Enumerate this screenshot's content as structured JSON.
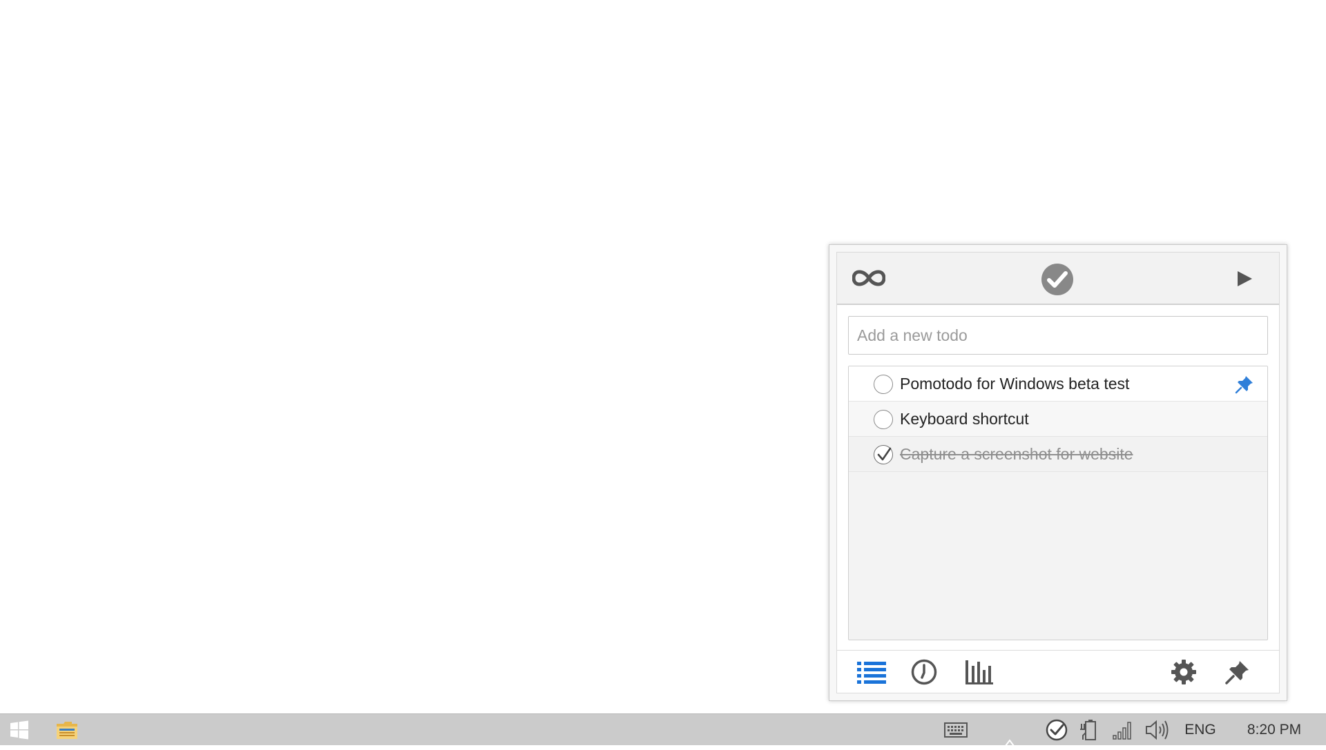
{
  "popup": {
    "new_todo_placeholder": "Add a new todo",
    "todos": [
      {
        "text": "Pomotodo for Windows beta test",
        "done": false,
        "pinned": true
      },
      {
        "text": "Keyboard shortcut",
        "done": false,
        "pinned": false
      },
      {
        "text": "Capture a screenshot for website",
        "done": true,
        "pinned": false
      }
    ],
    "top_icons": [
      "infinity-icon",
      "check-circle-icon",
      "play-icon"
    ],
    "bottom_icons": [
      "list-icon",
      "clock-icon",
      "bar-chart-icon",
      "gear-icon",
      "pin-icon"
    ],
    "accent_color": "#1a73d9"
  },
  "taskbar": {
    "language": "ENG",
    "time": "8:20 PM",
    "icons": [
      "windows-logo-icon",
      "file-explorer-icon",
      "keyboard-icon",
      "pomotodo-tray-icon",
      "power-icon",
      "network-icon",
      "volume-icon"
    ]
  }
}
